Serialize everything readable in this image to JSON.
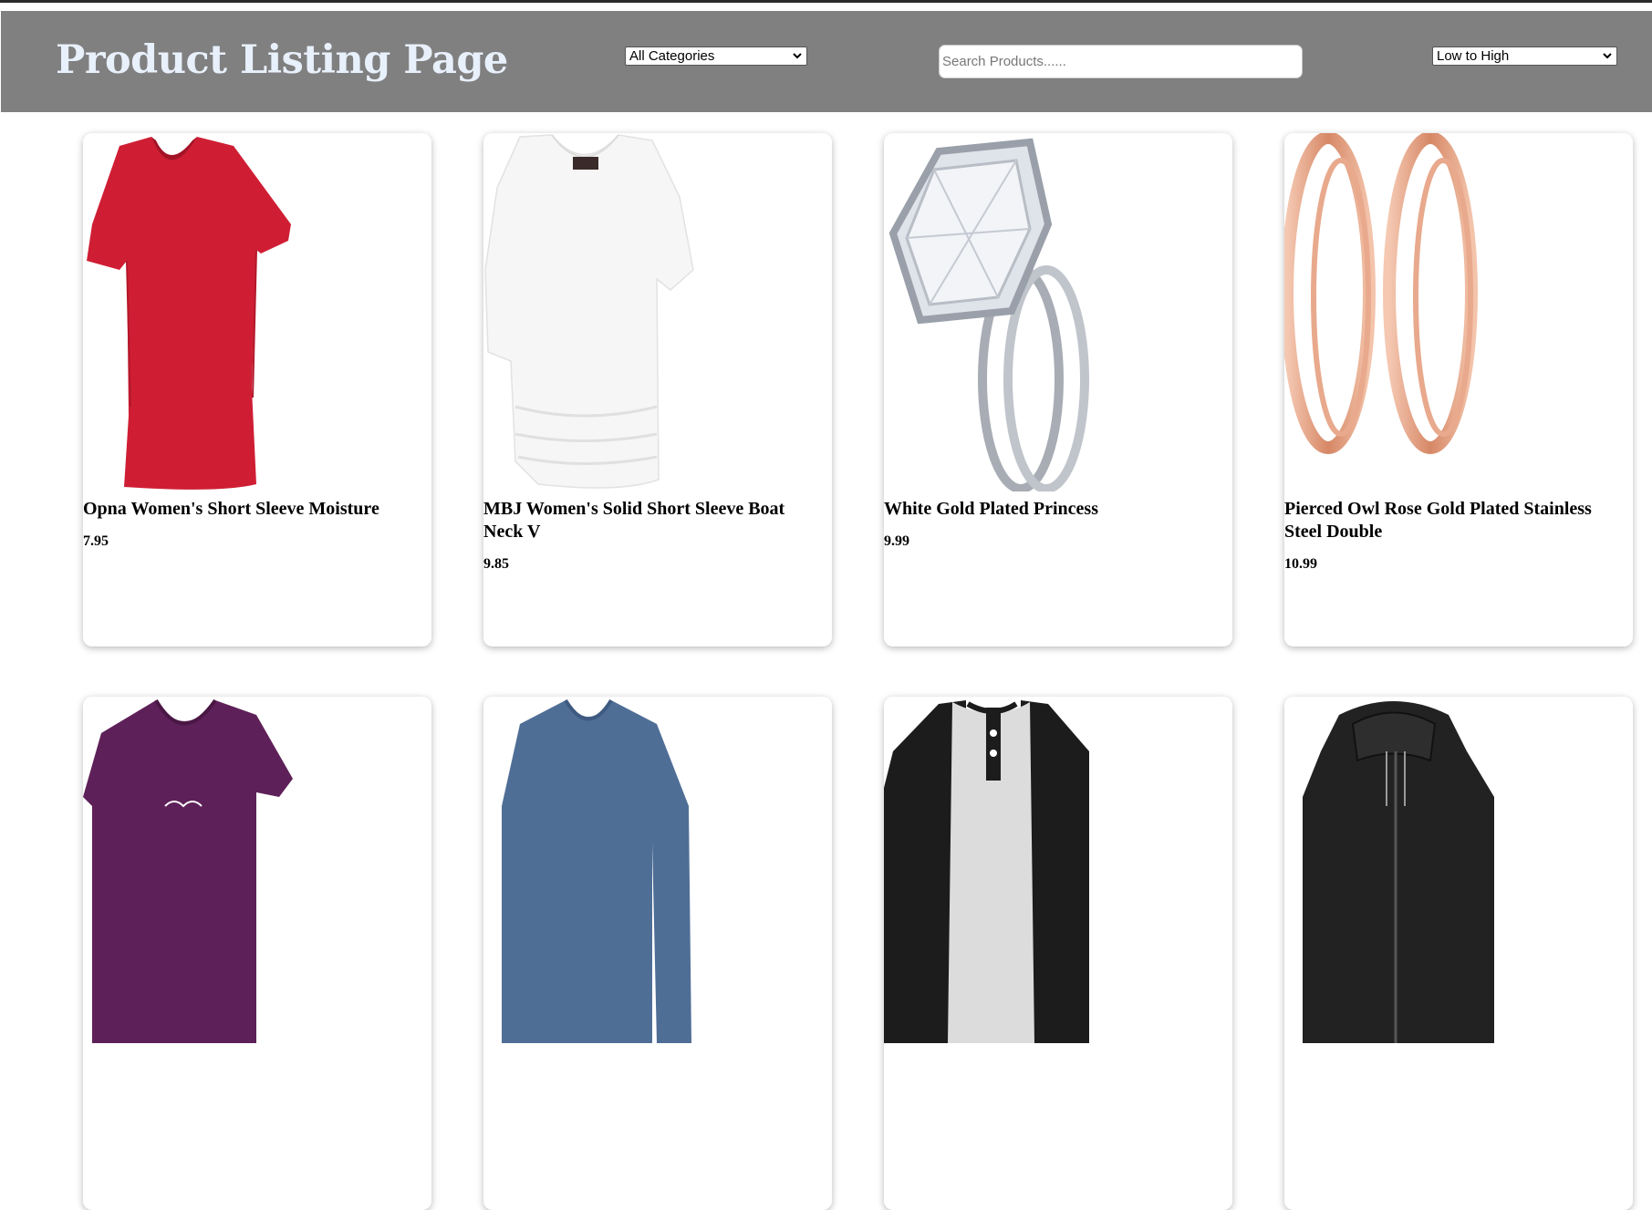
{
  "header": {
    "title": "Product Listing Page",
    "category_select": "All Categories",
    "search_placeholder": "Search Products......",
    "sort_select": "Low to High",
    "background": "#808080",
    "title_color": "#e8f0fb"
  },
  "products": [
    {
      "name": "Opna Women's Short Sleeve Moisture",
      "price": "7.95",
      "image": "red-vneck-shirt"
    },
    {
      "name": "MBJ Women's Solid Short Sleeve Boat Neck V",
      "price": "9.85",
      "image": "white-tunic-top"
    },
    {
      "name": "White Gold Plated Princess",
      "price": "9.99",
      "image": "diamond-ring-set"
    },
    {
      "name": "Pierced Owl Rose Gold Plated Stainless Steel Double",
      "price": "10.99",
      "image": "rose-gold-tunnel-plugs"
    },
    {
      "name": "",
      "price": "",
      "image": "purple-vneck-shirt"
    },
    {
      "name": "",
      "price": "",
      "image": "blue-longsleeve-vneck"
    },
    {
      "name": "",
      "price": "",
      "image": "henley-raglan-shirt"
    },
    {
      "name": "",
      "price": "",
      "image": "black-leather-hooded-jacket"
    }
  ]
}
